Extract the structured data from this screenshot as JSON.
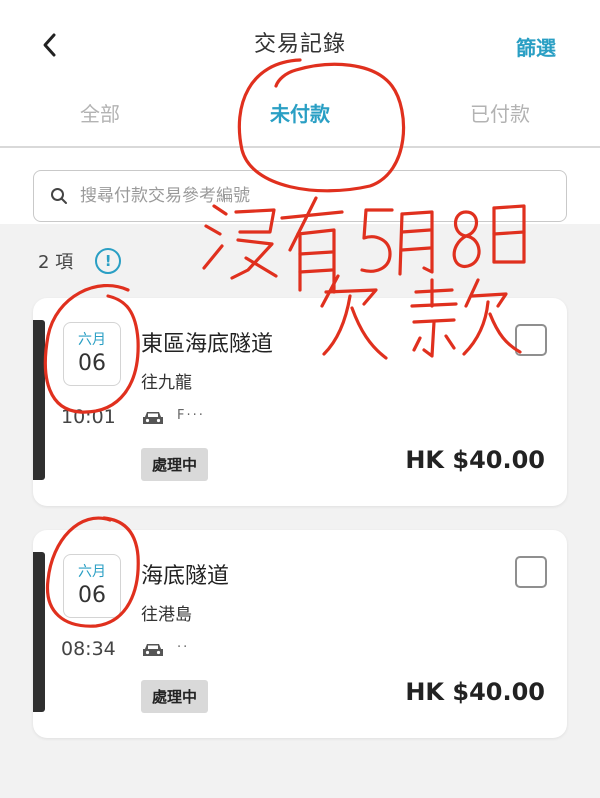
{
  "header": {
    "title": "交易記錄",
    "filter_label": "篩選"
  },
  "tabs": [
    {
      "label": "全部",
      "active": false
    },
    {
      "label": "未付款",
      "active": true
    },
    {
      "label": "已付款",
      "active": false
    }
  ],
  "search": {
    "placeholder": "搜尋付款交易參考編號",
    "value": ""
  },
  "count_label": "2 項",
  "info_glyph": "!",
  "transactions": [
    {
      "month": "六月",
      "day": "06",
      "time": "10:01",
      "route": "東區海底隧道",
      "direction": "往九龍",
      "plate": "F···",
      "status": "處理中",
      "amount": "HK $40.00"
    },
    {
      "month": "六月",
      "day": "06",
      "time": "08:34",
      "route": "海底隧道",
      "direction": "往港島",
      "plate": "··",
      "status": "處理中",
      "amount": "HK $40.00"
    }
  ],
  "colors": {
    "accent": "#2a9fc4",
    "annotation": "#e0301e",
    "card_bar": "#2f2f2f"
  }
}
